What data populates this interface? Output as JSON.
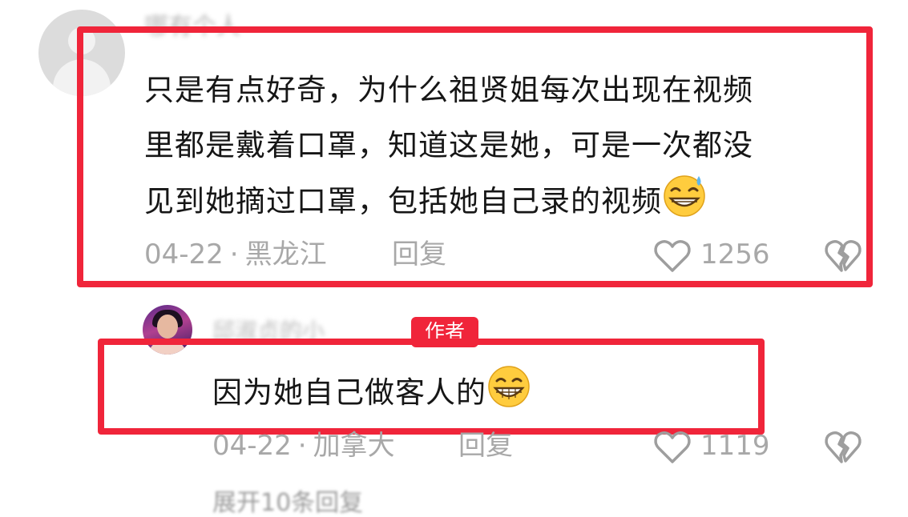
{
  "comment": {
    "author_name": "哪有个人",
    "text_lines": [
      "只是有点好奇，为什么祖贤姐每次出现在视频",
      "里都是戴着口罩，知道这是她，可是一次都没",
      "见到她摘过口罩，包括她自己录的视频"
    ],
    "date": "04-22",
    "location": "黑龙江",
    "reply_label": "回复",
    "like_count": "1256",
    "emoji_icon": "grinning-sweat-emoji",
    "like_icon": "heart-outline-icon",
    "dislike_icon": "broken-heart-icon"
  },
  "reply": {
    "author_name": "邱淑贞的小",
    "author_badge": "作者",
    "text": "因为她自己做客人的",
    "emoji_icon": "grinning-face-emoji",
    "date": "04-22",
    "location": "加拿大",
    "reply_label": "回复",
    "like_count": "1119"
  },
  "more_replies": "展开10条回复",
  "meta_separator": "·",
  "colors": {
    "highlight": "#f0253a",
    "badge": "#f0253a",
    "text": "#161616",
    "meta": "#a8a8a8"
  }
}
